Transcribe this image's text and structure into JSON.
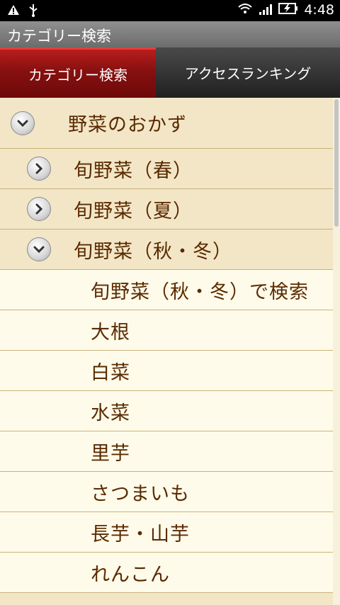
{
  "status_bar": {
    "time": "4:48",
    "icons": [
      "warning-icon",
      "usb-icon",
      "wifi-icon",
      "signal-icon",
      "battery-charging-icon"
    ]
  },
  "title_bar": {
    "title": "カテゴリー検索"
  },
  "tabs": [
    {
      "label": "カテゴリー検索",
      "active": true
    },
    {
      "label": "アクセスランキング",
      "active": false
    }
  ],
  "list": {
    "category": {
      "label": "野菜のおかず",
      "state": "expanded"
    },
    "subcategories": [
      {
        "label": "旬野菜（春）",
        "state": "collapsed"
      },
      {
        "label": "旬野菜（夏）",
        "state": "collapsed"
      },
      {
        "label": "旬野菜（秋・冬）",
        "state": "expanded"
      }
    ],
    "items": [
      "旬野菜（秋・冬）で検索",
      "大根",
      "白菜",
      "水菜",
      "里芋",
      "さつまいも",
      "長芋・山芋",
      "れんこん"
    ]
  },
  "colors": {
    "active_tab": "#861010",
    "parent_row_bg": "#f2e6c7",
    "child_row_bg": "#fffbea",
    "text": "#5a2a00"
  }
}
